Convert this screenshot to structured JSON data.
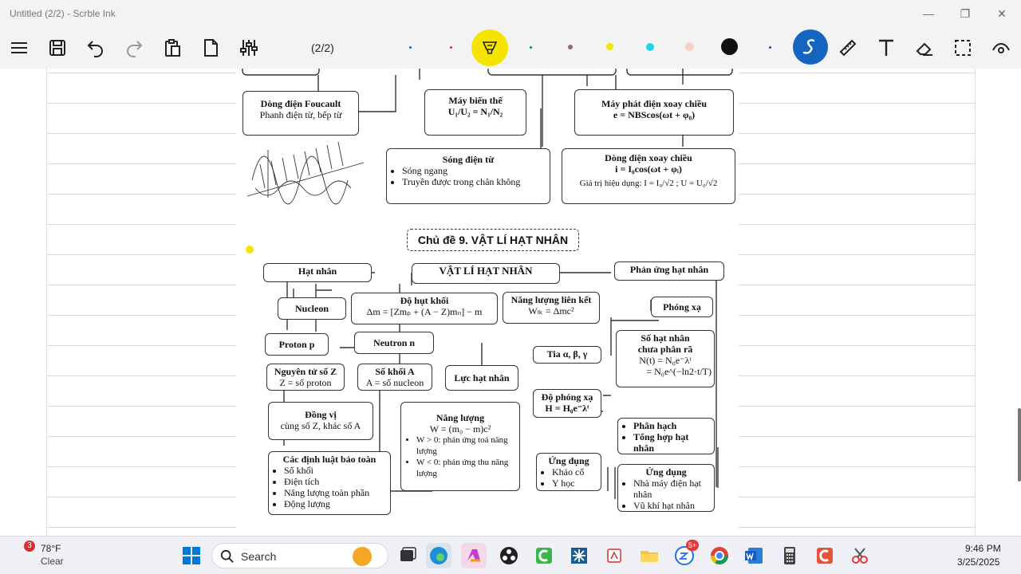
{
  "window": {
    "title": "Untitled (2/2) - Scrble Ink"
  },
  "toolbar": {
    "pager": "(2/2)"
  },
  "colors": {
    "accent": "#1565c0",
    "highlighter": "#f4e400",
    "taskbar": "#eef0f5"
  },
  "page_top": {
    "foucault": {
      "title": "Dòng điện Foucault",
      "line": "Phanh điện từ, bếp từ"
    },
    "transformer": {
      "title": "Máy biến thế",
      "formula": "U₁/U₂ = N₁/N₂"
    },
    "generator": {
      "title": "Máy phát điện xoay chiều",
      "formula": "e = NBScos(ωt + φ₀)"
    },
    "em_wave": {
      "title": "Sóng điện từ",
      "items": [
        "Sóng ngang",
        "Truyền được trong chân không"
      ]
    },
    "ac": {
      "title": "Dòng điện xoay chiều",
      "formula": "i = I₀cos(ωt + φᵢ)",
      "rms": "Giá trị hiệu dụng: I = I₀/√2 ; U = U₀/√2"
    }
  },
  "topic": {
    "heading": "Chủ đề 9. VẬT LÍ HẠT NHÂN",
    "center": "VẬT LÍ HẠT NHÂN",
    "nucleus": "Hạt nhân",
    "reaction": "Phản ứng hạt nhân",
    "nucleon": "Nucleon",
    "mass_defect": {
      "title": "Độ hụt khối",
      "formula": "Δm = [Zmₚ + (A − Z)mₙ] − m"
    },
    "binding": {
      "title": "Năng lượng liên kết",
      "formula": "Wₗₖ = Δmc²"
    },
    "radioactivity": "Phóng xạ",
    "proton": "Proton p",
    "neutron": "Neutron n",
    "remaining": {
      "l1": "Số hạt nhân",
      "l2": "chưa phân rã",
      "l3": "N(t) = N₀e⁻λᵗ",
      "l4": "= N₀e^(−ln2·t/T)"
    },
    "rays": "Tia α, β, γ",
    "atomic_number": {
      "title": "Nguyên tử số Z",
      "line": "Z = số proton"
    },
    "mass_number": {
      "title": "Số khối A",
      "line": "A = số nucleon"
    },
    "force": "Lực hạt nhân",
    "activity": {
      "title": "Độ phóng xạ",
      "formula": "H = H₀e⁻λᵗ"
    },
    "isotope": {
      "title": "Đồng vị",
      "line": "cùng số Z, khác số A"
    },
    "energy": {
      "title": "Năng lượng",
      "formula": "W = (m₀ − m)c²",
      "items": [
        "W > 0: phản ứng toả năng lượng",
        "W < 0: phản ứng thu năng lượng"
      ]
    },
    "fission": {
      "items": [
        "Phân hạch",
        "Tổng hợp hạt nhân"
      ]
    },
    "conservation": {
      "title": "Các định luật bảo toàn",
      "items": [
        "Số khối",
        "Điện tích",
        "Năng lượng toàn phần",
        "Động lượng"
      ]
    },
    "applications": {
      "title": "Ứng dụng",
      "items": [
        "Khảo cổ",
        "Y học"
      ]
    },
    "applications2": {
      "title": "Ứng dụng",
      "items": [
        "Nhà máy điện hạt nhân",
        "Vũ khí hạt nhân"
      ]
    }
  },
  "taskbar": {
    "weather": {
      "temp": "78°F",
      "cond": "Clear",
      "badge": "3"
    },
    "search_label": "Search",
    "clock": {
      "time": "9:46 PM",
      "date": "3/25/2025"
    }
  }
}
